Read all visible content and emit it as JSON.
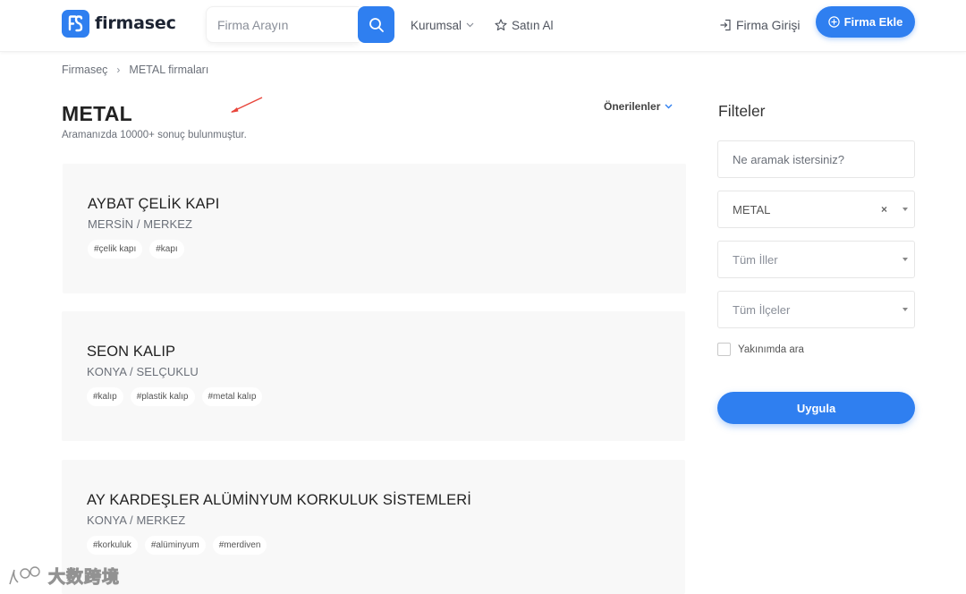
{
  "header": {
    "brand": "firmasec",
    "search_placeholder": "Firma Arayın",
    "nav": {
      "kurumsal": "Kurumsal",
      "satin_al": "Satın Al",
      "giris": "Firma Girişi",
      "add": "Firma Ekle"
    }
  },
  "breadcrumb": {
    "home": "Firmaseç",
    "sep": "›",
    "current": "METAL firmaları"
  },
  "page": {
    "title": "METAL",
    "result_count": "Aramanızda 10000+ sonuç bulunmuştur.",
    "sort_label": "Önerilenler"
  },
  "results": [
    {
      "name": "AYBAT ÇELİK KAPI",
      "location": "MERSİN / MERKEZ",
      "tags": [
        "#çelik kapı",
        "#kapı"
      ]
    },
    {
      "name": "SEON KALIP",
      "location": "KONYA / SELÇUKLU",
      "tags": [
        "#kalıp",
        "#plastik kalıp",
        "#metal kalıp"
      ]
    },
    {
      "name": "AY KARDEŞLER ALÜMİNYUM KORKULUK SİSTEMLERİ",
      "location": "KONYA / MERKEZ",
      "tags": [
        "#korkuluk",
        "#alüminyum",
        "#merdiven"
      ]
    }
  ],
  "filters": {
    "title": "Filteler",
    "keyword_placeholder": "Ne aramak istersiniz?",
    "sector_value": "METAL",
    "clear_symbol": "×",
    "city_placeholder": "Tüm İller",
    "district_placeholder": "Tüm İlçeler",
    "nearby_label": "Yakınımda ara",
    "apply_label": "Uygula"
  },
  "watermark": {
    "text": "大数跨境"
  },
  "colors": {
    "accent": "#2f7ff0",
    "card_bg": "#f8f8f8",
    "annotation": "#e8443a"
  },
  "icons": {
    "logo": "fs-logo-icon",
    "search": "search-icon",
    "chevron": "chevron-down-icon",
    "star": "star-icon",
    "login": "login-icon",
    "add": "plus-circle-icon"
  }
}
